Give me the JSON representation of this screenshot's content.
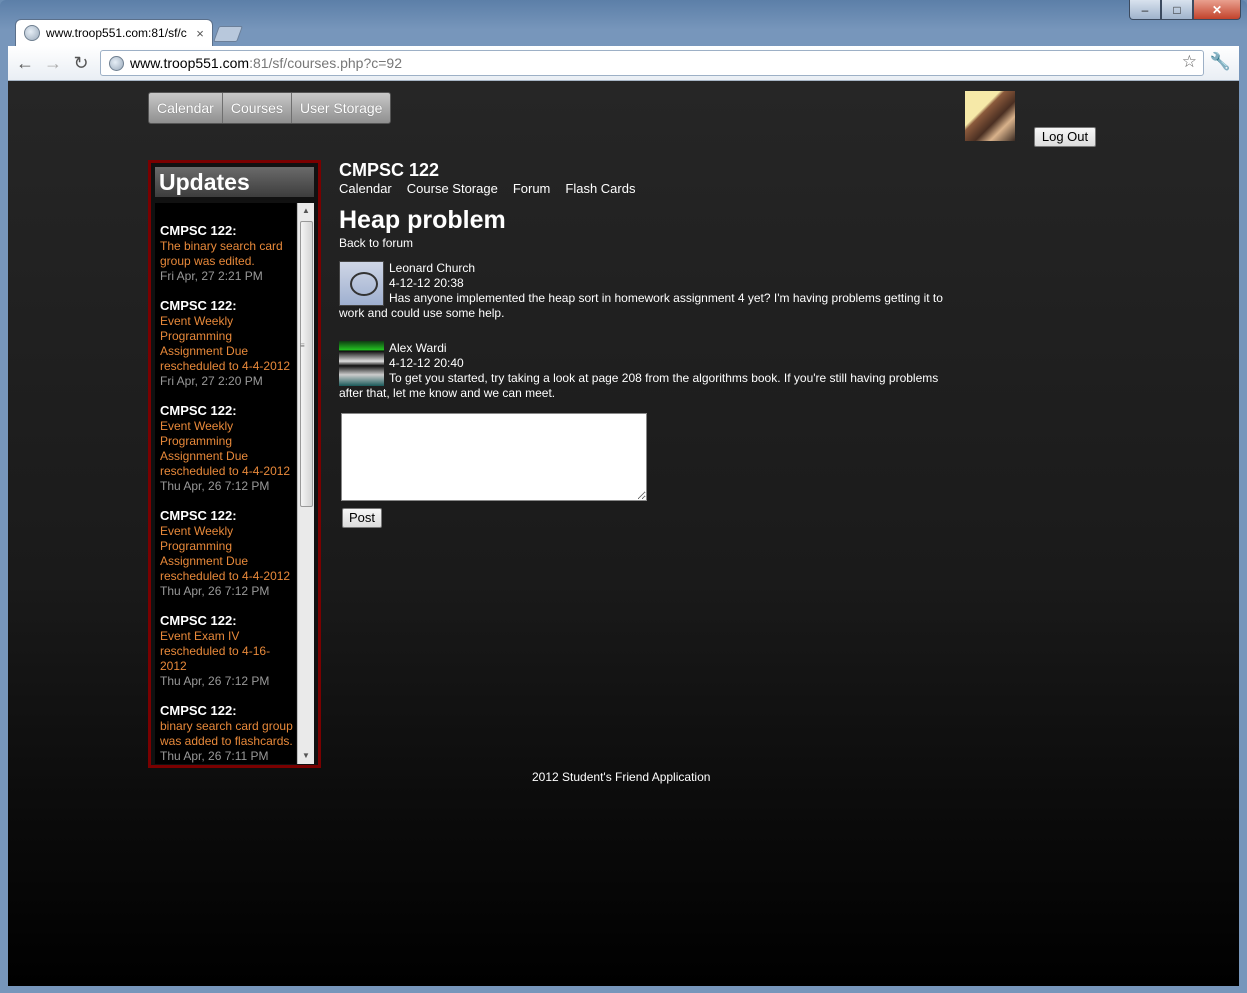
{
  "browser": {
    "tab_title": "www.troop551.com:81/sf/c",
    "url_host": "www.troop551.com",
    "url_rest": ":81/sf/courses.php?c=92"
  },
  "top_menu": [
    "Calendar",
    "Courses",
    "User Storage"
  ],
  "logout_label": "Log Out",
  "updates": {
    "title": "Updates",
    "items": [
      {
        "course": "CMPSC 122:",
        "text": "The binary search card group was edited.",
        "time": "Fri Apr, 27 2:21 PM"
      },
      {
        "course": "CMPSC 122:",
        "text": "Event Weekly Programming Assignment Due rescheduled to 4-4-2012",
        "time": "Fri Apr, 27 2:20 PM"
      },
      {
        "course": "CMPSC 122:",
        "text": "Event Weekly Programming Assignment Due rescheduled to 4-4-2012",
        "time": "Thu Apr, 26 7:12 PM"
      },
      {
        "course": "CMPSC 122:",
        "text": "Event Weekly Programming Assignment Due rescheduled to 4-4-2012",
        "time": "Thu Apr, 26 7:12 PM"
      },
      {
        "course": "CMPSC 122:",
        "text": "Event Exam IV rescheduled to 4-16-2012",
        "time": "Thu Apr, 26 7:12 PM"
      },
      {
        "course": "CMPSC 122:",
        "text": "binary search card group was added to flashcards.",
        "time": "Thu Apr, 26 7:11 PM"
      }
    ]
  },
  "course": {
    "title": "CMPSC 122",
    "subnav": [
      "Calendar",
      "Course Storage",
      "Forum",
      "Flash Cards"
    ]
  },
  "thread": {
    "title": "Heap problem",
    "back_link": "Back to forum",
    "posts": [
      {
        "author": "Leonard Church",
        "date": "4-12-12 20:38",
        "body": "Has anyone implemented the heap sort in homework assignment 4 yet? I'm having problems getting it to work and could use some help."
      },
      {
        "author": "Alex Wardi",
        "date": "4-12-12 20:40",
        "body": "To get you started, try taking a look at page 208 from the algorithms book. If you're still having problems after that, let me know and we can meet."
      }
    ]
  },
  "reply": {
    "value": "",
    "post_label": "Post"
  },
  "footer": "2012 Student's Friend Application"
}
